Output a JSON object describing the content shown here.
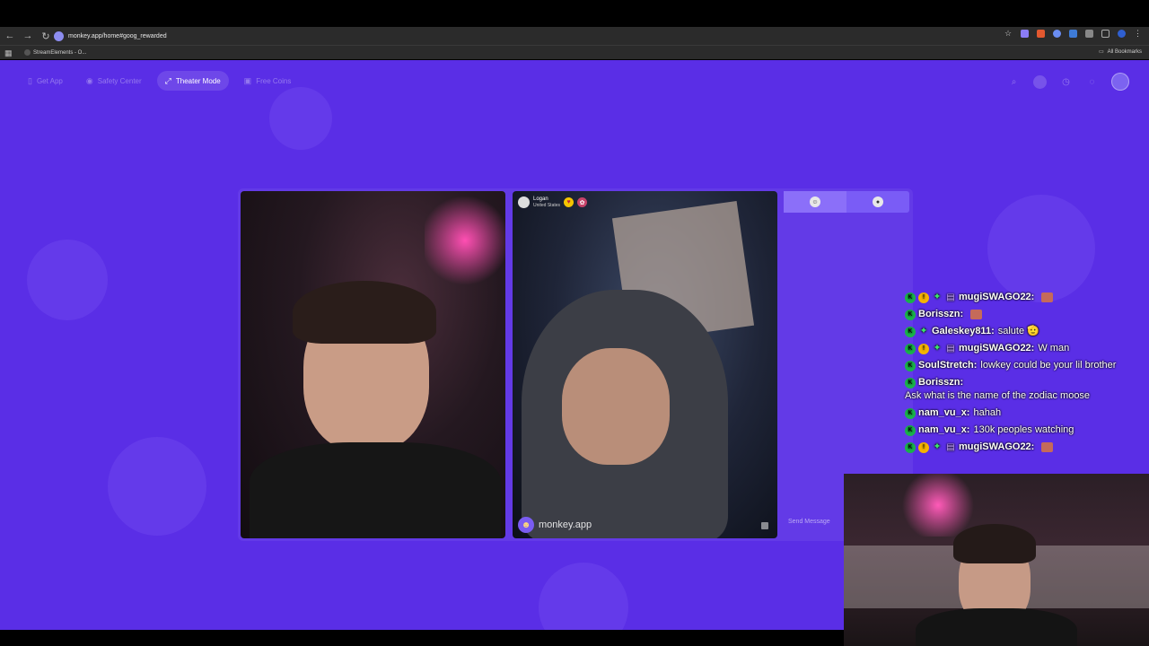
{
  "browser": {
    "url": "monkey.app/home#goog_rewarded",
    "bookmark_item": "StreamElements - O...",
    "all_bookmarks": "All Bookmarks"
  },
  "nav": {
    "get_app": "Get App",
    "safety_center": "Safety Center",
    "theater_mode": "Theater Mode",
    "free_coins": "Free Coins"
  },
  "remote_user": {
    "name": "Logan",
    "country": "United States"
  },
  "watermark": "monkey.app",
  "chat_panel": {
    "send_placeholder": "Send Message"
  },
  "overlay_chat": [
    {
      "user": "mugiSWAGO22:",
      "text": "",
      "emote": true,
      "badges": [
        "k",
        "gold",
        "star",
        "gift"
      ]
    },
    {
      "user": "Borisszn:",
      "text": "",
      "emote": true,
      "badges": [
        "k"
      ]
    },
    {
      "user": "Galeskey811:",
      "text": "salute 🫡",
      "emote": false,
      "badges": [
        "k",
        "star"
      ]
    },
    {
      "user": "mugiSWAGO22:",
      "text": "W man",
      "emote": false,
      "badges": [
        "k",
        "gold",
        "star",
        "gift"
      ]
    },
    {
      "user": "SoulStretch:",
      "text": "lowkey could be your lil brother",
      "emote": false,
      "badges": [
        "k"
      ]
    },
    {
      "user": "Borisszn:",
      "text": "Ask what is the name of the zodiac moose",
      "emote": false,
      "badges": [
        "k"
      ]
    },
    {
      "user": "nam_vu_x:",
      "text": "hahah",
      "emote": false,
      "badges": [
        "k"
      ]
    },
    {
      "user": "nam_vu_x:",
      "text": "130k peoples watching",
      "emote": false,
      "badges": [
        "k"
      ]
    },
    {
      "user": "mugiSWAGO22:",
      "text": "",
      "emote": true,
      "badges": [
        "k",
        "gold",
        "star",
        "gift"
      ]
    }
  ],
  "colors": {
    "page_bg": "#5a2ee6",
    "chat_tab_bg": "#7a5cf6",
    "badge_green": "#19b34a",
    "badge_gold": "#f5b400"
  },
  "icons": {
    "badge_k": "K",
    "badge_gold": "!",
    "badge_star": "✦",
    "badge_gift": "▤"
  }
}
